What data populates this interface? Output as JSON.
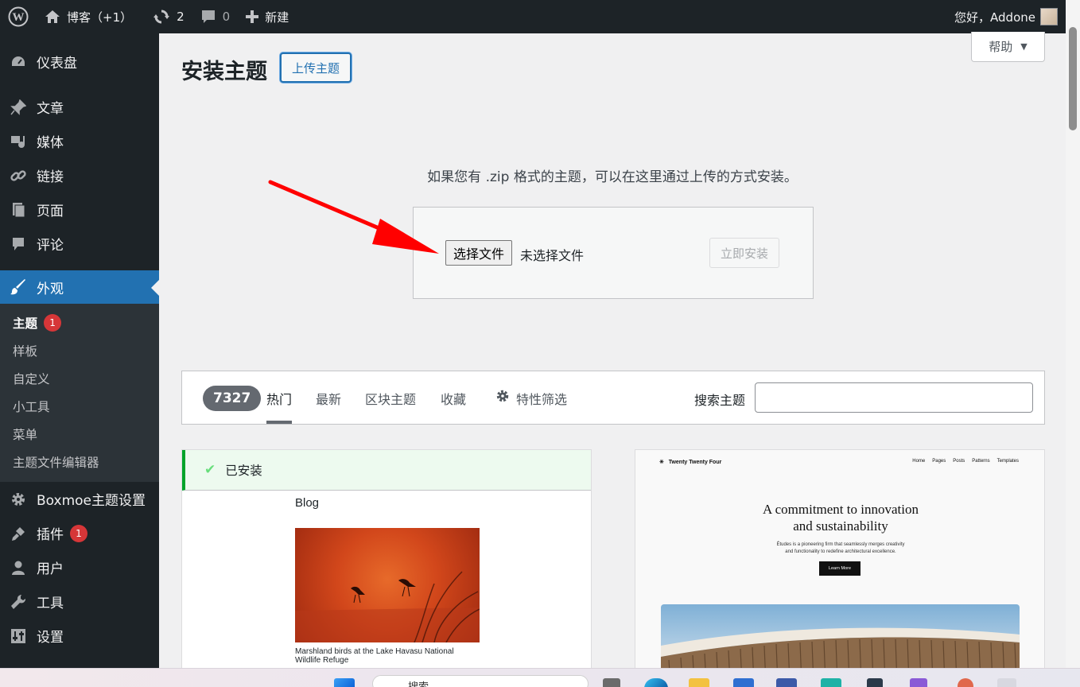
{
  "adminbar": {
    "site_name": "博客（+1）",
    "updates_count": "2",
    "comments_count": "0",
    "new_label": "新建",
    "greeting": "您好，Addone"
  },
  "sidebar": {
    "items": [
      {
        "label": "仪表盘",
        "icon": "dashboard-icon"
      },
      {
        "label": "文章",
        "icon": "pin-icon"
      },
      {
        "label": "媒体",
        "icon": "media-icon"
      },
      {
        "label": "链接",
        "icon": "link-icon"
      },
      {
        "label": "页面",
        "icon": "page-icon"
      },
      {
        "label": "评论",
        "icon": "comment-icon"
      },
      {
        "label": "外观",
        "icon": "brush-icon"
      }
    ],
    "appearance_submenu": [
      {
        "label": "主题",
        "badge": "1"
      },
      {
        "label": "样板"
      },
      {
        "label": "自定义"
      },
      {
        "label": "小工具"
      },
      {
        "label": "菜单"
      },
      {
        "label": "主题文件编辑器"
      }
    ],
    "items_after": [
      {
        "label": "Boxmoe主题设置",
        "icon": "gear-icon"
      },
      {
        "label": "插件",
        "icon": "plugin-icon",
        "badge": "1"
      },
      {
        "label": "用户",
        "icon": "user-icon"
      },
      {
        "label": "工具",
        "icon": "wrench-icon"
      },
      {
        "label": "设置",
        "icon": "settings-icon"
      }
    ]
  },
  "main": {
    "title": "安装主题",
    "upload_button": "上传主题",
    "help_label": "帮助",
    "upload_description": "如果您有 .zip 格式的主题，可以在这里通过上传的方式安装。",
    "choose_file_button": "选择文件",
    "no_file_text": "未选择文件",
    "install_now_button": "立即安装"
  },
  "filter": {
    "count": "7327",
    "tabs": [
      "热门",
      "最新",
      "区块主题",
      "收藏",
      "特性筛选"
    ],
    "search_label": "搜索主题",
    "search_value": ""
  },
  "themes": [
    {
      "installed_label": "已安装",
      "preview_title": "Blog",
      "preview_caption": "Marshland birds at the Lake Havasu National Wildlife Refuge"
    },
    {
      "preview_logo": "Twenty Twenty Four",
      "preview_nav": [
        "Home",
        "Pages",
        "Posts",
        "Patterns",
        "Templates"
      ],
      "preview_heading_line1": "A commitment to innovation",
      "preview_heading_line2": "and sustainability",
      "preview_sub_line1": "Études is a pioneering firm that seamlessly merges creativity",
      "preview_sub_line2": "and functionality to redefine architectural excellence.",
      "preview_button": "Learn More"
    }
  ],
  "taskbar": {
    "search_text": "搜索"
  },
  "colors": {
    "admin_dark": "#1d2327",
    "accent_blue": "#2271b1",
    "badge_red": "#d63638",
    "installed_green": "#00a32a",
    "arrow_red": "#ff0000"
  }
}
